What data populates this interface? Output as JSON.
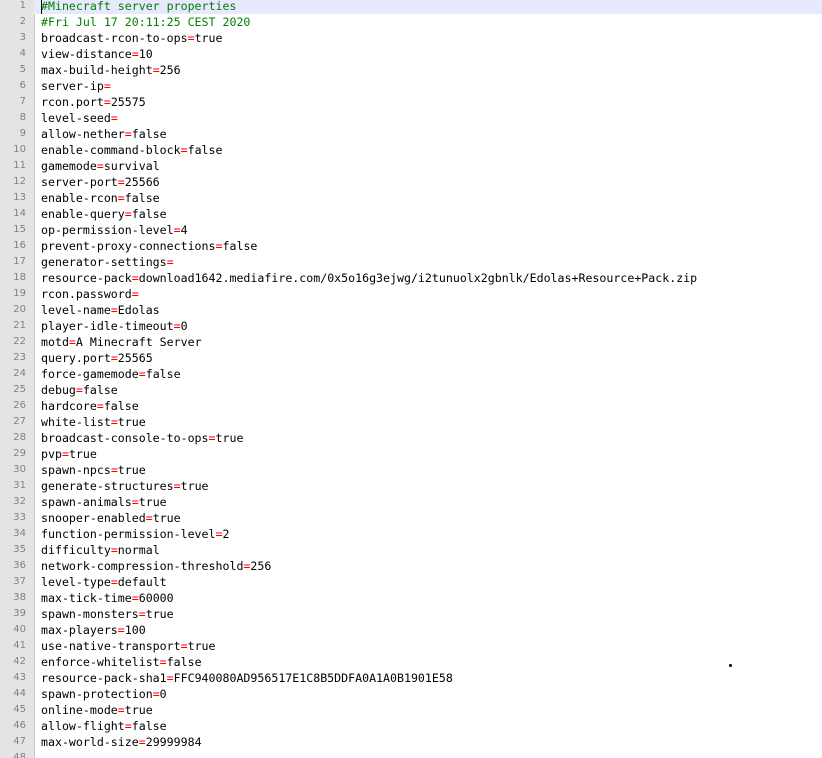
{
  "editor": {
    "colors": {
      "comment": "#008000",
      "operator": "#ff0000",
      "text": "#000000",
      "gutter_bg": "#e4e4e4",
      "line_number": "#808080",
      "current_line": "#e8e8ff"
    },
    "current_line": 1,
    "lines": [
      {
        "n": "1",
        "type": "comment",
        "text": "#Minecraft server properties"
      },
      {
        "n": "2",
        "type": "comment",
        "text": "#Fri Jul 17 20:11:25 CEST 2020"
      },
      {
        "n": "3",
        "type": "kv",
        "key": "broadcast-rcon-to-ops",
        "value": "true"
      },
      {
        "n": "4",
        "type": "kv",
        "key": "view-distance",
        "value": "10"
      },
      {
        "n": "5",
        "type": "kv",
        "key": "max-build-height",
        "value": "256"
      },
      {
        "n": "6",
        "type": "kv",
        "key": "server-ip",
        "value": ""
      },
      {
        "n": "7",
        "type": "kv",
        "key": "rcon.port",
        "value": "25575"
      },
      {
        "n": "8",
        "type": "kv",
        "key": "level-seed",
        "value": ""
      },
      {
        "n": "9",
        "type": "kv",
        "key": "allow-nether",
        "value": "false"
      },
      {
        "n": "10",
        "type": "kv",
        "key": "enable-command-block",
        "value": "false"
      },
      {
        "n": "11",
        "type": "kv",
        "key": "gamemode",
        "value": "survival"
      },
      {
        "n": "12",
        "type": "kv",
        "key": "server-port",
        "value": "25566"
      },
      {
        "n": "13",
        "type": "kv",
        "key": "enable-rcon",
        "value": "false"
      },
      {
        "n": "14",
        "type": "kv",
        "key": "enable-query",
        "value": "false"
      },
      {
        "n": "15",
        "type": "kv",
        "key": "op-permission-level",
        "value": "4"
      },
      {
        "n": "16",
        "type": "kv",
        "key": "prevent-proxy-connections",
        "value": "false"
      },
      {
        "n": "17",
        "type": "kv",
        "key": "generator-settings",
        "value": ""
      },
      {
        "n": "18",
        "type": "kv",
        "key": "resource-pack",
        "value": "download1642.mediafire.com/0x5o16g3ejwg/i2tunuolx2gbnlk/Edolas+Resource+Pack.zip"
      },
      {
        "n": "19",
        "type": "kv",
        "key": "rcon.password",
        "value": ""
      },
      {
        "n": "20",
        "type": "kv",
        "key": "level-name",
        "value": "Edolas"
      },
      {
        "n": "21",
        "type": "kv",
        "key": "player-idle-timeout",
        "value": "0"
      },
      {
        "n": "22",
        "type": "kv",
        "key": "motd",
        "value": "A Minecraft Server"
      },
      {
        "n": "23",
        "type": "kv",
        "key": "query.port",
        "value": "25565"
      },
      {
        "n": "24",
        "type": "kv",
        "key": "force-gamemode",
        "value": "false"
      },
      {
        "n": "25",
        "type": "kv",
        "key": "debug",
        "value": "false"
      },
      {
        "n": "26",
        "type": "kv",
        "key": "hardcore",
        "value": "false"
      },
      {
        "n": "27",
        "type": "kv",
        "key": "white-list",
        "value": "true"
      },
      {
        "n": "28",
        "type": "kv",
        "key": "broadcast-console-to-ops",
        "value": "true"
      },
      {
        "n": "29",
        "type": "kv",
        "key": "pvp",
        "value": "true"
      },
      {
        "n": "30",
        "type": "kv",
        "key": "spawn-npcs",
        "value": "true"
      },
      {
        "n": "31",
        "type": "kv",
        "key": "generate-structures",
        "value": "true"
      },
      {
        "n": "32",
        "type": "kv",
        "key": "spawn-animals",
        "value": "true"
      },
      {
        "n": "33",
        "type": "kv",
        "key": "snooper-enabled",
        "value": "true"
      },
      {
        "n": "34",
        "type": "kv",
        "key": "function-permission-level",
        "value": "2"
      },
      {
        "n": "35",
        "type": "kv",
        "key": "difficulty",
        "value": "normal"
      },
      {
        "n": "36",
        "type": "kv",
        "key": "network-compression-threshold",
        "value": "256"
      },
      {
        "n": "37",
        "type": "kv",
        "key": "level-type",
        "value": "default"
      },
      {
        "n": "38",
        "type": "kv",
        "key": "max-tick-time",
        "value": "60000"
      },
      {
        "n": "39",
        "type": "kv",
        "key": "spawn-monsters",
        "value": "true"
      },
      {
        "n": "40",
        "type": "kv",
        "key": "max-players",
        "value": "100"
      },
      {
        "n": "41",
        "type": "kv",
        "key": "use-native-transport",
        "value": "true"
      },
      {
        "n": "42",
        "type": "kv",
        "key": "enforce-whitelist",
        "value": "false"
      },
      {
        "n": "43",
        "type": "kv",
        "key": "resource-pack-sha1",
        "value": "FFC940080AD956517E1C8B5DDFA0A1A0B1901E58"
      },
      {
        "n": "44",
        "type": "kv",
        "key": "spawn-protection",
        "value": "0"
      },
      {
        "n": "45",
        "type": "kv",
        "key": "online-mode",
        "value": "true"
      },
      {
        "n": "46",
        "type": "kv",
        "key": "allow-flight",
        "value": "false"
      },
      {
        "n": "47",
        "type": "kv",
        "key": "max-world-size",
        "value": "29999984"
      },
      {
        "n": "48",
        "type": "empty",
        "text": ""
      }
    ]
  }
}
